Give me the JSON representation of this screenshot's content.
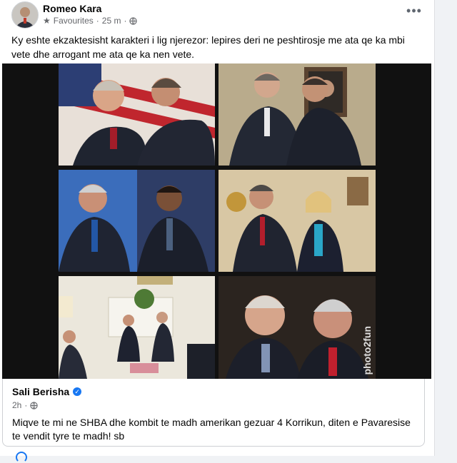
{
  "post": {
    "author": "Romeo Kara",
    "audience": "Favourites",
    "time": "25 m",
    "text": "Ky eshte ekzaktesisht karakteri i lig njerezor: lepires deri ne peshtirosje me ata qe ka mbi vete dhe arrogant me ata qe ka nen vete.",
    "icons": {
      "avatar": "avatar",
      "star": "star-icon",
      "globe": "globe-icon",
      "more": "more-options-icon"
    }
  },
  "photo": {
    "watermark": "photo2fun",
    "tiles": [
      "tile-1",
      "tile-2",
      "tile-3",
      "tile-4",
      "tile-5",
      "tile-6"
    ]
  },
  "shared": {
    "author": "Sali Berisha",
    "time": "2h",
    "text": "Miqve te mi ne SHBA dhe kombit te madh amerikan gezuar 4 Korrikun, diten e Pavaresise te vendit tyre te madh! sb",
    "accent": "#1877f2"
  }
}
